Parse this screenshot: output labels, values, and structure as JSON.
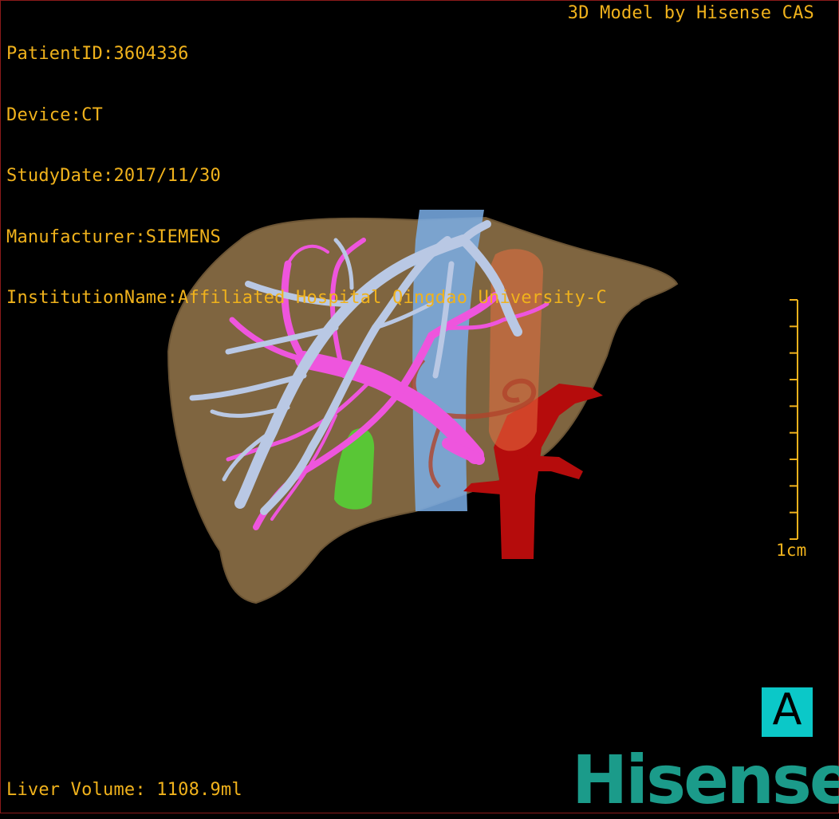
{
  "study_info": {
    "patient_id": "PatientID:3604336",
    "device": "Device:CT",
    "study_date": "StudyDate:2017/11/30",
    "manufacturer": "Manufacturer:SIEMENS",
    "institution": "InstitutionName:Affiliated Hospital Qingdao University-C"
  },
  "credit": "3D Model by Hisense CAS",
  "liver_volume": "Liver Volume: 1108.9ml",
  "scale_bar": {
    "label": "1cm",
    "ticks": 10
  },
  "orientation_marker": "A",
  "brand": "Hisense",
  "colors": {
    "overlay_text": "#f0b21c",
    "liver": "#8a6e45",
    "hepatic_vein": "#b9c8e4",
    "portal_vein": "#ee55dd",
    "ivc": "#6aa6e8",
    "aorta": "#b50c0c",
    "gallbladder": "#55d035",
    "artery": "#e87040",
    "brand": "#1b9b8a",
    "orientation_box": "#0bc8c8"
  }
}
